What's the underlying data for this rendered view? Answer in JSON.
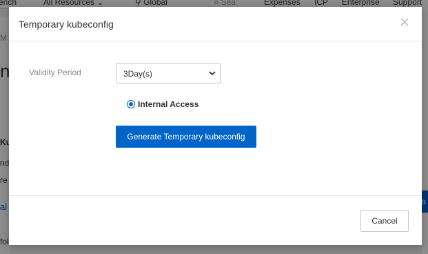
{
  "background": {
    "topbar": {
      "workbench": "ench",
      "resources": "All Resources",
      "region": "Global",
      "search_placeholder": "Sea",
      "expenses": "Expenses",
      "icp": "ICP",
      "enterprise": "Enterprise",
      "support": "Support"
    },
    "left_fragments": {
      "breadcrumb": "M",
      "heading": "n",
      "kube": "Kul",
      "line1": "nd",
      "line2": "re",
      "tab": "al",
      "line3": "fol"
    },
    "right_button_fragment": "ra"
  },
  "modal": {
    "title": "Temporary kubeconfig",
    "validity_label": "Validity Period",
    "validity_value": "3Day(s)",
    "access_option_label": "Internal Access",
    "generate_button": "Generate Temporary kubeconfig",
    "cancel_button": "Cancel"
  },
  "colors": {
    "primary": "#0064c8",
    "overlay": "rgba(0,0,0,0.45)"
  }
}
